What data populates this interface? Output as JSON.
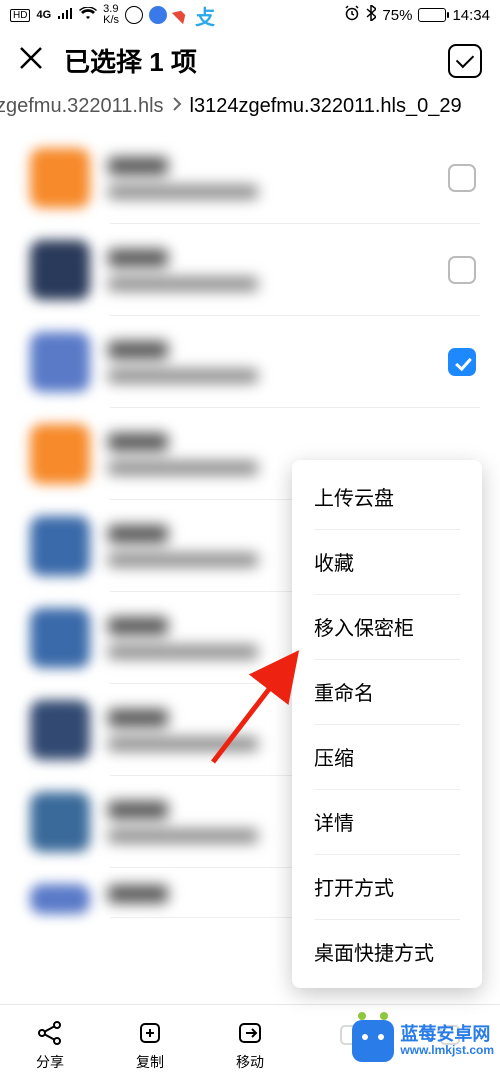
{
  "status": {
    "hd": "HD",
    "net": "4G",
    "speed_num": "3.9",
    "speed_unit": "K/s",
    "bt_pct": "75%",
    "time": "14:34"
  },
  "header": {
    "title": "已选择 1 项"
  },
  "breadcrumb": {
    "prev": "zgefmu.322011.hls",
    "curr": "l3124zgefmu.322011.hls_0_29"
  },
  "popup": {
    "items": [
      "上传云盘",
      "收藏",
      "移入保密柜",
      "重命名",
      "压缩",
      "详情",
      "打开方式",
      "桌面快捷方式"
    ]
  },
  "bottom": {
    "share": "分享",
    "copy": "复制",
    "move": "移动"
  },
  "watermark": {
    "cn": "蓝莓安卓网",
    "url": "www.lmkjst.com"
  }
}
